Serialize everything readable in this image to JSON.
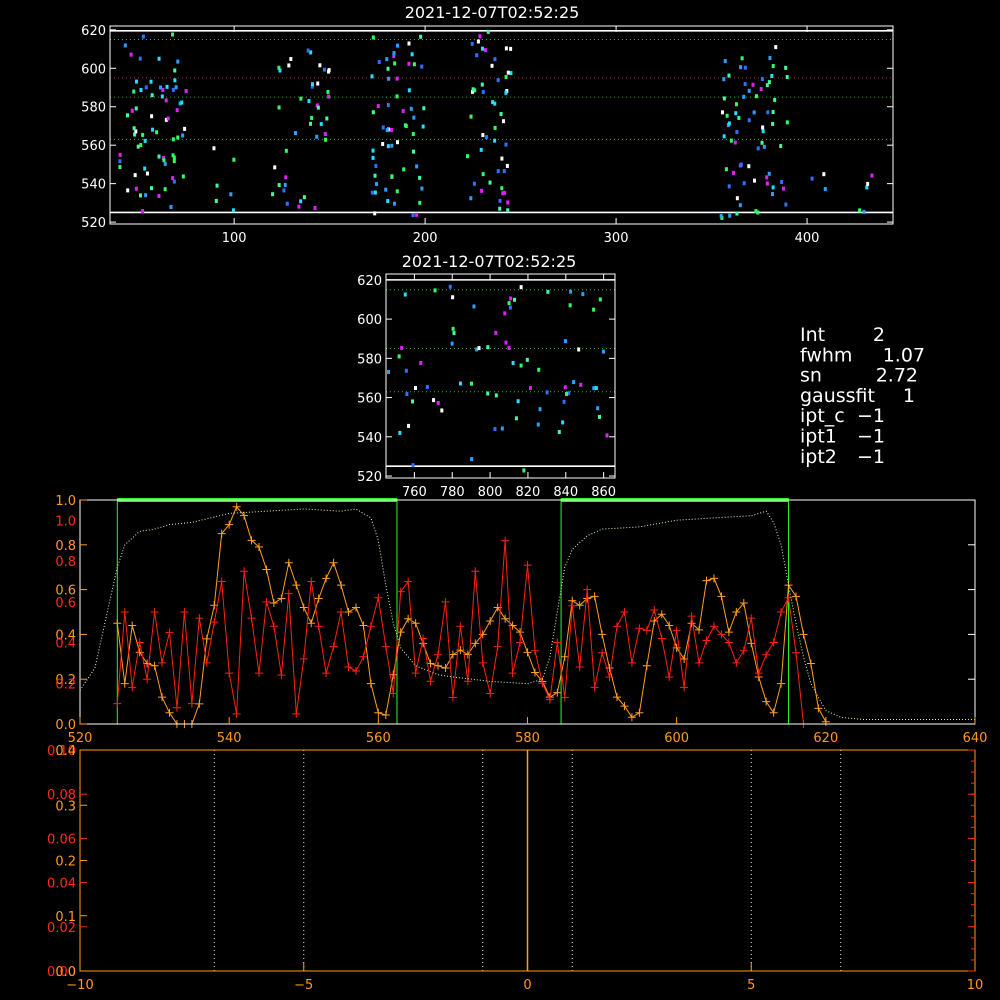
{
  "colors": {
    "background": "#000000",
    "axis_white": "#ffffff",
    "orange": "#ffa020",
    "red": "#ff2010",
    "green": "#22ff22",
    "green_dotted": "#22c022",
    "red_dotted": "#c02020",
    "light_dotted": "#d8ffb0"
  },
  "info_panel": {
    "rows": [
      {
        "label": "Int",
        "value": "2"
      },
      {
        "label": "fwhm",
        "value": "1.07"
      },
      {
        "label": "sn",
        "value": "2.72"
      },
      {
        "label": "gaussfit",
        "value": "1"
      },
      {
        "label": "ipt_c",
        "value": "−1"
      },
      {
        "label": "ipt1",
        "value": "−1"
      },
      {
        "label": "ipt2",
        "value": "−1"
      }
    ]
  },
  "chart_data": [
    {
      "type": "scatter",
      "title": "2021-12-07T02:52:25",
      "xlim": [
        35,
        445
      ],
      "ylim": [
        519,
        622
      ],
      "xticks": [
        100,
        200,
        300,
        400
      ],
      "yticks": [
        520,
        540,
        560,
        580,
        600,
        620
      ],
      "hlines": [
        {
          "y": 619.5,
          "style": "solid",
          "color": "#ffffff"
        },
        {
          "y": 615,
          "style": "dotted",
          "color": "#22c022"
        },
        {
          "y": 595,
          "style": "dotted",
          "color": "#c02020"
        },
        {
          "y": 585,
          "style": "dotted",
          "color": "#22c022"
        },
        {
          "y": 563,
          "style": "dotted",
          "color": "#22c022"
        },
        {
          "y": 525,
          "style": "solid",
          "color": "#ffffff"
        }
      ],
      "clusters": [
        {
          "x": [
            40,
            75
          ],
          "y": [
            525,
            618
          ],
          "n": 70
        },
        {
          "x": [
            85,
            100
          ],
          "y": [
            525,
            560
          ],
          "n": 6
        },
        {
          "x": [
            120,
            150
          ],
          "y": [
            525,
            618
          ],
          "n": 40
        },
        {
          "x": [
            172,
            200
          ],
          "y": [
            522,
            620
          ],
          "n": 60
        },
        {
          "x": [
            222,
            245
          ],
          "y": [
            525,
            620
          ],
          "n": 50
        },
        {
          "x": [
            355,
            392
          ],
          "y": [
            522,
            615
          ],
          "n": 70
        },
        {
          "x": [
            400,
            435
          ],
          "y": [
            525,
            545
          ],
          "n": 8
        }
      ]
    },
    {
      "type": "scatter",
      "title": "2021-12-07T02:52:25",
      "xlim": [
        745,
        866
      ],
      "ylim": [
        519,
        623
      ],
      "xticks": [
        760,
        780,
        800,
        820,
        840,
        860
      ],
      "yticks": [
        520,
        540,
        560,
        580,
        600,
        620
      ],
      "hlines": [
        {
          "y": 620,
          "style": "solid",
          "color": "#ffffff"
        },
        {
          "y": 615,
          "style": "dotted",
          "color": "#22c022"
        },
        {
          "y": 585,
          "style": "dotted",
          "color": "#22c022"
        },
        {
          "y": 563,
          "style": "dotted",
          "color": "#22c022"
        },
        {
          "y": 525,
          "style": "solid",
          "color": "#ffffff"
        }
      ],
      "clusters": [
        {
          "x": [
            746,
            865
          ],
          "y": [
            522,
            620
          ],
          "n": 75
        }
      ]
    },
    {
      "type": "line",
      "xlim": [
        520,
        640
      ],
      "xticks": [
        520,
        540,
        560,
        580,
        600,
        620,
        640
      ],
      "ylim_left_orange": [
        0,
        1.0
      ],
      "yticks_left_orange": [
        0.0,
        0.2,
        0.4,
        0.6,
        0.8,
        1.0
      ],
      "ylim_left_red": [
        0,
        1.1
      ],
      "yticks_left_red": [
        0.2,
        0.4,
        0.6,
        0.8,
        1.0
      ],
      "green_boxes": [
        [
          525,
          562.5
        ],
        [
          584.5,
          615
        ]
      ],
      "series": [
        {
          "color": "#ffa020",
          "x": [
            525,
            526,
            527,
            528,
            529,
            530,
            531,
            532,
            533,
            534,
            535,
            536,
            537,
            538,
            539,
            540,
            541,
            542,
            543,
            544,
            545,
            546,
            547,
            548,
            549,
            550,
            551,
            552,
            553,
            554,
            555,
            556,
            557,
            558,
            559,
            560,
            561,
            562,
            563,
            564,
            565,
            566,
            567,
            568,
            569,
            570,
            571,
            572,
            573,
            574,
            575,
            576,
            577,
            578,
            579,
            580,
            581,
            582,
            583,
            584,
            585,
            586,
            587,
            588,
            589,
            590,
            591,
            592,
            593,
            594,
            595,
            596,
            597,
            598,
            599,
            600,
            601,
            602,
            603,
            604,
            605,
            606,
            607,
            608,
            609,
            610,
            611,
            612,
            613,
            614,
            615,
            616,
            617,
            618,
            619,
            620
          ],
          "y": [
            0.45,
            0.18,
            0.44,
            0.32,
            0.27,
            0.26,
            0.12,
            0.05,
            0.0,
            0.0,
            0.0,
            0.09,
            0.38,
            0.53,
            0.85,
            0.89,
            0.97,
            0.93,
            0.82,
            0.79,
            0.69,
            0.54,
            0.56,
            0.72,
            0.62,
            0.52,
            0.45,
            0.56,
            0.65,
            0.72,
            0.62,
            0.5,
            0.52,
            0.44,
            0.18,
            0.05,
            0.04,
            0.22,
            0.41,
            0.47,
            0.45,
            0.36,
            0.27,
            0.26,
            0.25,
            0.31,
            0.33,
            0.31,
            0.36,
            0.4,
            0.46,
            0.52,
            0.47,
            0.44,
            0.41,
            0.32,
            0.23,
            0.19,
            0.12,
            0.14,
            0.3,
            0.55,
            0.53,
            0.56,
            0.57,
            0.4,
            0.25,
            0.12,
            0.08,
            0.03,
            0.05,
            0.26,
            0.46,
            0.49,
            0.44,
            0.34,
            0.29,
            0.45,
            0.42,
            0.64,
            0.65,
            0.57,
            0.41,
            0.5,
            0.54,
            0.36,
            0.21,
            0.1,
            0.05,
            0.18,
            0.62,
            0.57,
            0.4,
            0.27,
            0.07,
            0.01
          ]
        },
        {
          "color": "#ff2010",
          "x": [
            525,
            526,
            527,
            528,
            529,
            530,
            531,
            532,
            533,
            534,
            535,
            536,
            537,
            538,
            539,
            540,
            541,
            542,
            543,
            544,
            545,
            546,
            547,
            548,
            549,
            550,
            551,
            552,
            553,
            554,
            555,
            556,
            557,
            558,
            559,
            560,
            561,
            562,
            563,
            564,
            565,
            566,
            567,
            568,
            569,
            570,
            571,
            572,
            573,
            574,
            575,
            576,
            577,
            578,
            579,
            580,
            581,
            582,
            583,
            584,
            585,
            586,
            587,
            588,
            589,
            590,
            591,
            592,
            593,
            594,
            595,
            596,
            597,
            598,
            599,
            600,
            601,
            602,
            603,
            604,
            605,
            606,
            607,
            608,
            609,
            610,
            611,
            612,
            613,
            614,
            615,
            616,
            617
          ],
          "y": [
            0.1,
            0.55,
            0.18,
            0.4,
            0.22,
            0.55,
            0.3,
            0.45,
            0.08,
            0.55,
            0.1,
            0.52,
            0.3,
            0.5,
            0.7,
            0.25,
            0.05,
            0.75,
            0.52,
            0.25,
            0.6,
            0.48,
            0.24,
            0.64,
            0.05,
            0.32,
            0.7,
            0.48,
            0.25,
            0.38,
            0.55,
            0.28,
            0.26,
            0.33,
            0.48,
            0.62,
            0.38,
            0.15,
            0.65,
            0.7,
            0.25,
            0.42,
            0.21,
            0.34,
            0.6,
            0.13,
            0.48,
            0.21,
            0.75,
            0.3,
            0.15,
            0.38,
            0.9,
            0.25,
            0.4,
            0.78,
            0.36,
            0.2,
            0.12,
            0.4,
            0.13,
            0.58,
            0.28,
            0.66,
            0.18,
            0.35,
            0.23,
            0.48,
            0.55,
            0.3,
            0.47,
            0.46,
            0.56,
            0.42,
            0.23,
            0.46,
            0.18,
            0.53,
            0.3,
            0.41,
            0.48,
            0.44,
            0.4,
            0.3,
            0.36,
            0.52,
            0.25,
            0.34,
            0.4,
            0.55,
            0.62,
            0.35,
            0.0
          ]
        },
        {
          "color": "#d8ffb0",
          "style": "dotted",
          "x": [
            520,
            522,
            524,
            525,
            526,
            528,
            530,
            532,
            535,
            540,
            545,
            550,
            555,
            557,
            559,
            560,
            561,
            562,
            563,
            565,
            568,
            570,
            575,
            580,
            582,
            583,
            584,
            585,
            586,
            588,
            590,
            595,
            600,
            605,
            610,
            612,
            613,
            614,
            615,
            616,
            617,
            618,
            620,
            622,
            625,
            630,
            635,
            640
          ],
          "y": [
            0.15,
            0.25,
            0.55,
            0.7,
            0.8,
            0.86,
            0.87,
            0.89,
            0.9,
            0.94,
            0.95,
            0.96,
            0.95,
            0.96,
            0.92,
            0.82,
            0.62,
            0.45,
            0.34,
            0.26,
            0.22,
            0.21,
            0.19,
            0.18,
            0.2,
            0.3,
            0.5,
            0.7,
            0.78,
            0.84,
            0.87,
            0.88,
            0.91,
            0.92,
            0.93,
            0.95,
            0.9,
            0.8,
            0.62,
            0.45,
            0.3,
            0.18,
            0.06,
            0.03,
            0.02,
            0.02,
            0.02,
            0.02
          ]
        }
      ]
    },
    {
      "type": "line",
      "xlim": [
        -10,
        10
      ],
      "xticks": [
        -10,
        -5,
        0,
        5,
        10
      ],
      "ylim_red": [
        0,
        0.1
      ],
      "yticks_red": [
        "0.00",
        "0.02",
        "0.04",
        "0.06",
        "0.08",
        "0.10"
      ],
      "ylim_orange": [
        0,
        0.4
      ],
      "yticks_orange": [
        "0.0",
        "0.1",
        "0.2",
        "0.3",
        "0.4"
      ],
      "vlines_dotted": [
        -7,
        -5,
        -1,
        1,
        5,
        7
      ],
      "vline_solid": 0
    }
  ]
}
